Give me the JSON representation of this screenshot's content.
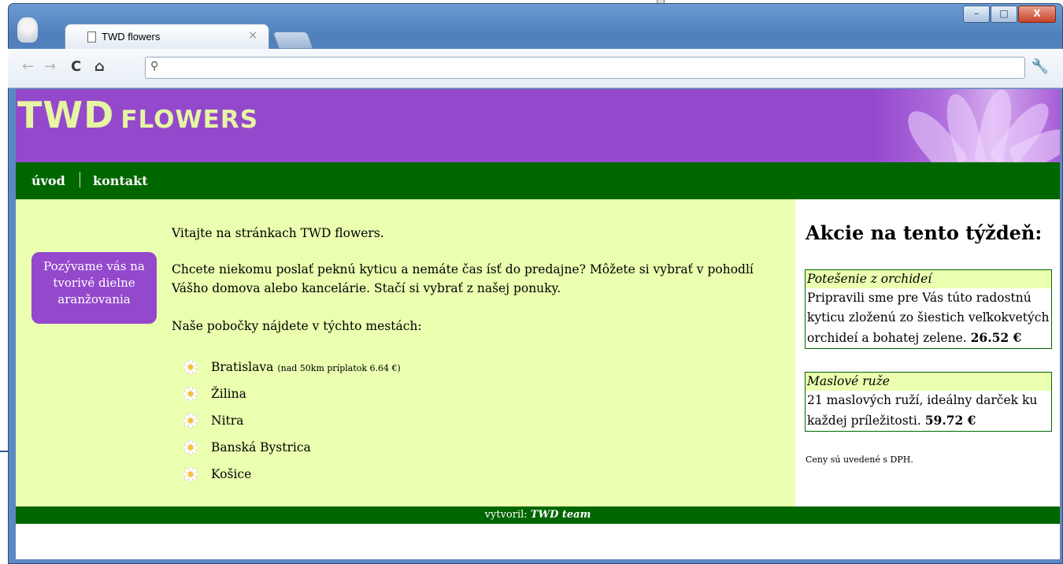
{
  "browser": {
    "tab_title": "TWD flowers",
    "tab_close": "×",
    "address_value": "",
    "window_controls": [
      "–",
      "□",
      "X"
    ]
  },
  "site": {
    "title_main": "TWD",
    "title_sub": "FLOWERS",
    "brand_color": "#9449cc",
    "nav_color": "#006600",
    "content_bg": "#eaffb0",
    "title_color": "#e6f5a3"
  },
  "nav": {
    "items": [
      {
        "label": "úvod"
      },
      {
        "label": "kontakt"
      }
    ]
  },
  "promo": {
    "text": "Pozývame vás na tvorivé dielne aranžovania"
  },
  "main": {
    "welcome": "Vitajte na stránkach TWD flowers.",
    "intro": "Chcete niekomu poslať peknú kyticu a nemáte čas ísť do predajne? Môžete si vybrať v pohodlí Vášho domova alebo kancelárie. Stačí si vybrať z našej ponuky.",
    "branches_heading": "Naše pobočky nájdete v týchto mestách:",
    "cities": [
      {
        "name": "Bratislava",
        "note": "(nad 50km príplatok 6.64 €)"
      },
      {
        "name": "Žilina",
        "note": ""
      },
      {
        "name": "Nitra",
        "note": ""
      },
      {
        "name": "Banská Bystrica",
        "note": ""
      },
      {
        "name": "Košice",
        "note": ""
      }
    ]
  },
  "sidebar": {
    "heading": "Akcie na tento týždeň:",
    "offers": [
      {
        "title": "Potešenie z orchideí",
        "text": "Pripravili sme pre Vás túto radostnú kyticu zloženú zo šiestich veľkokvetých orchideí a bohatej zelene.",
        "price": "26.52 €"
      },
      {
        "title": "Maslové ruže",
        "text": "21 maslových ruží, ideálny darček ku každej príležitosti.",
        "price": "59.72 €"
      }
    ],
    "vat_note": "Ceny sú uvedené s DPH."
  },
  "footer": {
    "prefix": "vytvoril:",
    "team": "TWD team"
  },
  "icons": {
    "back": "back-arrow-icon",
    "forward": "forward-arrow-icon",
    "reload": "reload-icon",
    "home": "home-icon",
    "search": "search-icon",
    "wrench": "wrench-icon",
    "city_bullet": "daisy-icon"
  }
}
